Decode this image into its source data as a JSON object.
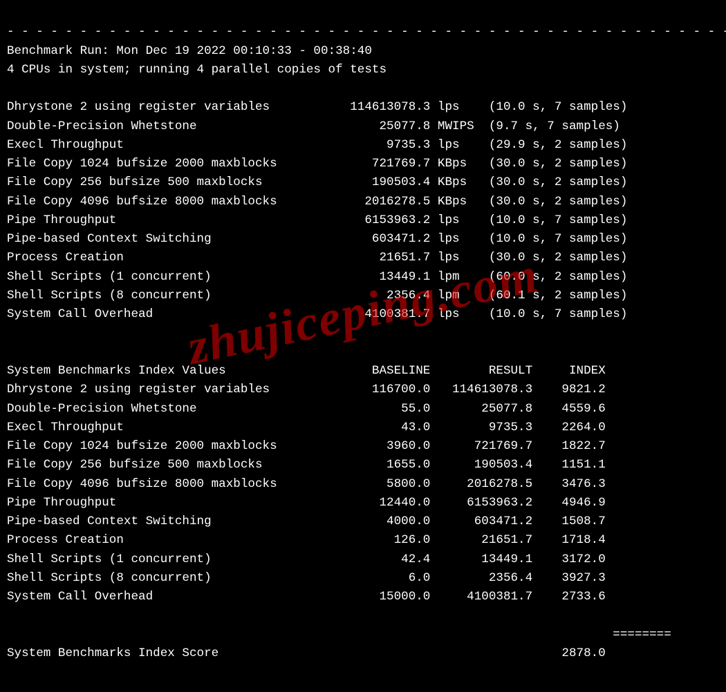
{
  "divider": "- - - - - - - - - - - - - - - - - - - - - - - - - - - - - - - - - - - - - - - - - - - - - - - - - -",
  "run_line": "Benchmark Run: Mon Dec 19 2022 00:10:33 - 00:38:40",
  "cpu_line": "4 CPUs in system; running 4 parallel copies of tests",
  "watermark": "zhujiceping.com",
  "results": [
    {
      "name": "Dhrystone 2 using register variables",
      "value": "114613078.3",
      "unit": "lps",
      "timing": "(10.0 s, 7 samples)"
    },
    {
      "name": "Double-Precision Whetstone",
      "value": "25077.8",
      "unit": "MWIPS",
      "timing": "(9.7 s, 7 samples)"
    },
    {
      "name": "Execl Throughput",
      "value": "9735.3",
      "unit": "lps",
      "timing": "(29.9 s, 2 samples)"
    },
    {
      "name": "File Copy 1024 bufsize 2000 maxblocks",
      "value": "721769.7",
      "unit": "KBps",
      "timing": "(30.0 s, 2 samples)"
    },
    {
      "name": "File Copy 256 bufsize 500 maxblocks",
      "value": "190503.4",
      "unit": "KBps",
      "timing": "(30.0 s, 2 samples)"
    },
    {
      "name": "File Copy 4096 bufsize 8000 maxblocks",
      "value": "2016278.5",
      "unit": "KBps",
      "timing": "(30.0 s, 2 samples)"
    },
    {
      "name": "Pipe Throughput",
      "value": "6153963.2",
      "unit": "lps",
      "timing": "(10.0 s, 7 samples)"
    },
    {
      "name": "Pipe-based Context Switching",
      "value": "603471.2",
      "unit": "lps",
      "timing": "(10.0 s, 7 samples)"
    },
    {
      "name": "Process Creation",
      "value": "21651.7",
      "unit": "lps",
      "timing": "(30.0 s, 2 samples)"
    },
    {
      "name": "Shell Scripts (1 concurrent)",
      "value": "13449.1",
      "unit": "lpm",
      "timing": "(60.0 s, 2 samples)"
    },
    {
      "name": "Shell Scripts (8 concurrent)",
      "value": "2356.4",
      "unit": "lpm",
      "timing": "(60.1 s, 2 samples)"
    },
    {
      "name": "System Call Overhead",
      "value": "4100381.7",
      "unit": "lps",
      "timing": "(10.0 s, 7 samples)"
    }
  ],
  "index_header": {
    "title": "System Benchmarks Index Values",
    "col_baseline": "BASELINE",
    "col_result": "RESULT",
    "col_index": "INDEX"
  },
  "index_rows": [
    {
      "name": "Dhrystone 2 using register variables",
      "baseline": "116700.0",
      "result": "114613078.3",
      "index": "9821.2"
    },
    {
      "name": "Double-Precision Whetstone",
      "baseline": "55.0",
      "result": "25077.8",
      "index": "4559.6"
    },
    {
      "name": "Execl Throughput",
      "baseline": "43.0",
      "result": "9735.3",
      "index": "2264.0"
    },
    {
      "name": "File Copy 1024 bufsize 2000 maxblocks",
      "baseline": "3960.0",
      "result": "721769.7",
      "index": "1822.7"
    },
    {
      "name": "File Copy 256 bufsize 500 maxblocks",
      "baseline": "1655.0",
      "result": "190503.4",
      "index": "1151.1"
    },
    {
      "name": "File Copy 4096 bufsize 8000 maxblocks",
      "baseline": "5800.0",
      "result": "2016278.5",
      "index": "3476.3"
    },
    {
      "name": "Pipe Throughput",
      "baseline": "12440.0",
      "result": "6153963.2",
      "index": "4946.9"
    },
    {
      "name": "Pipe-based Context Switching",
      "baseline": "4000.0",
      "result": "603471.2",
      "index": "1508.7"
    },
    {
      "name": "Process Creation",
      "baseline": "126.0",
      "result": "21651.7",
      "index": "1718.4"
    },
    {
      "name": "Shell Scripts (1 concurrent)",
      "baseline": "42.4",
      "result": "13449.1",
      "index": "3172.0"
    },
    {
      "name": "Shell Scripts (8 concurrent)",
      "baseline": "6.0",
      "result": "2356.4",
      "index": "3927.3"
    },
    {
      "name": "System Call Overhead",
      "baseline": "15000.0",
      "result": "4100381.7",
      "index": "2733.6"
    }
  ],
  "score_divider": "                                                                                   ========",
  "score_line": {
    "label": "System Benchmarks Index Score",
    "value": "2878.0"
  }
}
